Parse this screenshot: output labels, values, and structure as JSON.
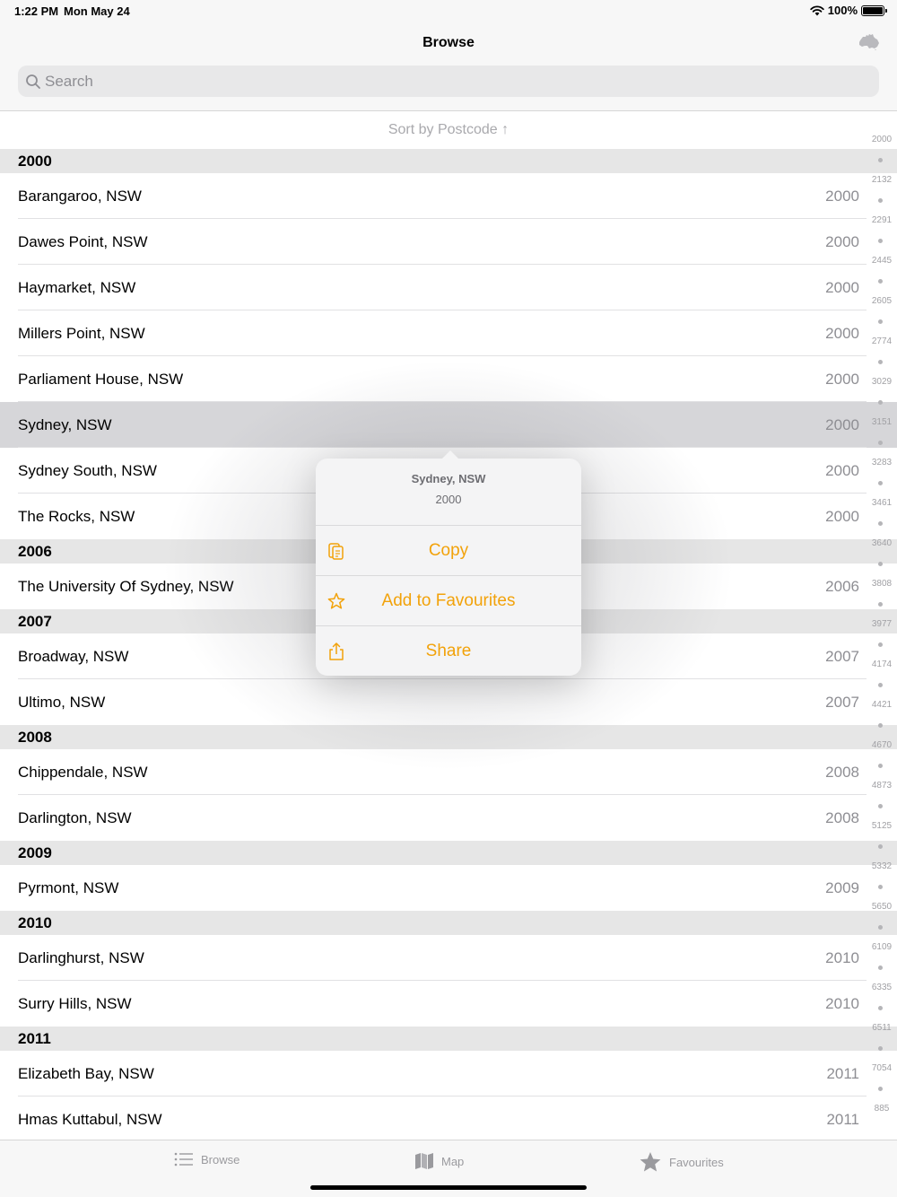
{
  "status": {
    "time": "1:22 PM",
    "date": "Mon May 24",
    "battery": "100%"
  },
  "nav": {
    "title": "Browse",
    "map_icon": "australia-map-icon"
  },
  "search": {
    "placeholder": "Search"
  },
  "list": {
    "sort_label": "Sort by Postcode ↑",
    "sections": [
      {
        "header": "2000",
        "rows": [
          {
            "name": "Barangaroo, NSW",
            "code": "2000"
          },
          {
            "name": "Dawes Point, NSW",
            "code": "2000"
          },
          {
            "name": "Haymarket, NSW",
            "code": "2000"
          },
          {
            "name": "Millers Point, NSW",
            "code": "2000"
          },
          {
            "name": "Parliament House, NSW",
            "code": "2000"
          },
          {
            "name": "Sydney, NSW",
            "code": "2000",
            "selected": true
          },
          {
            "name": "Sydney South, NSW",
            "code": "2000"
          },
          {
            "name": "The Rocks, NSW",
            "code": "2000"
          }
        ]
      },
      {
        "header": "2006",
        "rows": [
          {
            "name": "The University Of Sydney, NSW",
            "code": "2006"
          }
        ]
      },
      {
        "header": "2007",
        "rows": [
          {
            "name": "Broadway, NSW",
            "code": "2007"
          },
          {
            "name": "Ultimo, NSW",
            "code": "2007"
          }
        ]
      },
      {
        "header": "2008",
        "rows": [
          {
            "name": "Chippendale, NSW",
            "code": "2008"
          },
          {
            "name": "Darlington, NSW",
            "code": "2008"
          }
        ]
      },
      {
        "header": "2009",
        "rows": [
          {
            "name": "Pyrmont, NSW",
            "code": "2009"
          }
        ]
      },
      {
        "header": "2010",
        "rows": [
          {
            "name": "Darlinghurst, NSW",
            "code": "2010"
          },
          {
            "name": "Surry Hills, NSW",
            "code": "2010"
          }
        ]
      },
      {
        "header": "2011",
        "rows": [
          {
            "name": "Elizabeth Bay, NSW",
            "code": "2011"
          },
          {
            "name": "Hmas Kuttabul, NSW",
            "code": "2011"
          }
        ]
      }
    ]
  },
  "index": [
    "2000",
    "2132",
    "2291",
    "2445",
    "2605",
    "2774",
    "3029",
    "3151",
    "3283",
    "3461",
    "3640",
    "3808",
    "3977",
    "4174",
    "4421",
    "4670",
    "4873",
    "5125",
    "5332",
    "5650",
    "6109",
    "6335",
    "6511",
    "7054",
    "885"
  ],
  "context_menu": {
    "title": "Sydney, NSW",
    "subtitle": "2000",
    "items": [
      {
        "label": "Copy",
        "icon": "copy-icon"
      },
      {
        "label": "Add to Favourites",
        "icon": "star-outline-icon"
      },
      {
        "label": "Share",
        "icon": "share-icon"
      }
    ],
    "accent": "#f2a20a"
  },
  "tabbar": {
    "browse": "Browse",
    "map": "Map",
    "favourites": "Favourites"
  }
}
